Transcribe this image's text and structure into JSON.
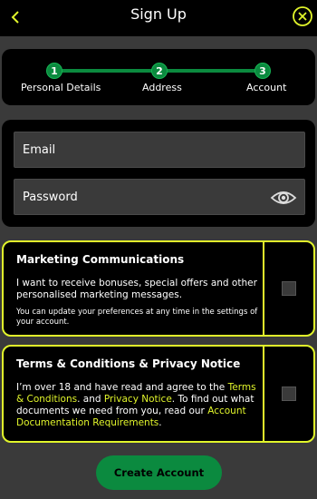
{
  "header": {
    "title": "Sign Up"
  },
  "stepper": {
    "steps": [
      {
        "number": "1",
        "label": "Personal Details"
      },
      {
        "number": "2",
        "label": "Address"
      },
      {
        "number": "3",
        "label": "Account"
      }
    ]
  },
  "form": {
    "email_placeholder": "Email",
    "password_placeholder": "Password"
  },
  "marketing": {
    "title": "Marketing Communications",
    "text": "I want to receive bonuses, special offers and other personalised marketing messages.",
    "note": "You can update your preferences at any time in the settings of your account."
  },
  "terms": {
    "title": "Terms & Conditions & Privacy Notice",
    "text_prefix": "I’m over 18 and have read and agree to the",
    "link_terms": "Terms & Conditions",
    "text_and": ". and",
    "link_privacy": "Privacy Notice",
    "text_middle": ". To find out what documents we need from you, read our",
    "link_docs": "Account Documentation Requirements",
    "text_end": "."
  },
  "actions": {
    "create_account": "Create Account"
  },
  "colors": {
    "accent_yellow": "#e1f52b",
    "brand_green": "#0b8a3f"
  },
  "icons": {
    "back": "chevron-left-icon",
    "close": "close-circle-icon",
    "password_toggle": "eye-icon"
  }
}
